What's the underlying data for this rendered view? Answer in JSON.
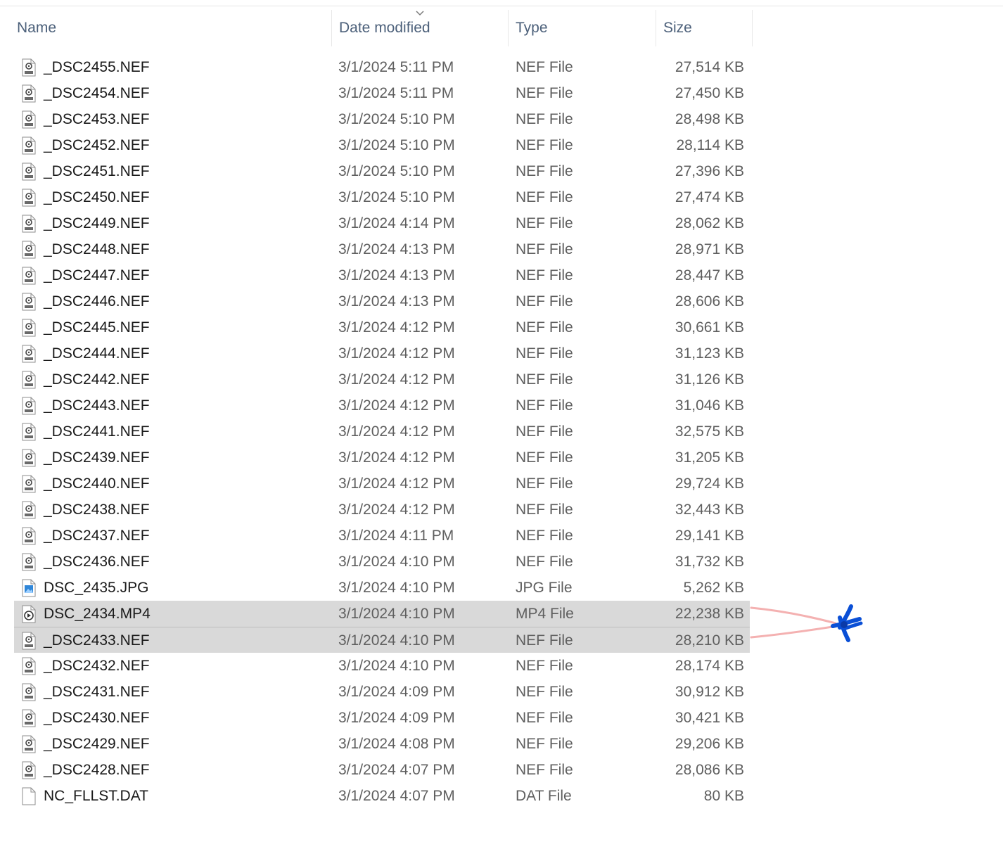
{
  "columns": {
    "name": "Name",
    "date": "Date modified",
    "type": "Type",
    "size": "Size"
  },
  "sort": {
    "column": "Date modified",
    "direction": "descending",
    "icon": "chevron-down-icon"
  },
  "files": [
    {
      "name": "_DSC2455.NEF",
      "date": "3/1/2024 5:11 PM",
      "type": "NEF File",
      "size": "27,514 KB",
      "icon": "nef-file-icon"
    },
    {
      "name": "_DSC2454.NEF",
      "date": "3/1/2024 5:11 PM",
      "type": "NEF File",
      "size": "27,450 KB",
      "icon": "nef-file-icon"
    },
    {
      "name": "_DSC2453.NEF",
      "date": "3/1/2024 5:10 PM",
      "type": "NEF File",
      "size": "28,498 KB",
      "icon": "nef-file-icon"
    },
    {
      "name": "_DSC2452.NEF",
      "date": "3/1/2024 5:10 PM",
      "type": "NEF File",
      "size": "28,114 KB",
      "icon": "nef-file-icon"
    },
    {
      "name": "_DSC2451.NEF",
      "date": "3/1/2024 5:10 PM",
      "type": "NEF File",
      "size": "27,396 KB",
      "icon": "nef-file-icon"
    },
    {
      "name": "_DSC2450.NEF",
      "date": "3/1/2024 5:10 PM",
      "type": "NEF File",
      "size": "27,474 KB",
      "icon": "nef-file-icon"
    },
    {
      "name": "_DSC2449.NEF",
      "date": "3/1/2024 4:14 PM",
      "type": "NEF File",
      "size": "28,062 KB",
      "icon": "nef-file-icon"
    },
    {
      "name": "_DSC2448.NEF",
      "date": "3/1/2024 4:13 PM",
      "type": "NEF File",
      "size": "28,971 KB",
      "icon": "nef-file-icon"
    },
    {
      "name": "_DSC2447.NEF",
      "date": "3/1/2024 4:13 PM",
      "type": "NEF File",
      "size": "28,447 KB",
      "icon": "nef-file-icon"
    },
    {
      "name": "_DSC2446.NEF",
      "date": "3/1/2024 4:13 PM",
      "type": "NEF File",
      "size": "28,606 KB",
      "icon": "nef-file-icon"
    },
    {
      "name": "_DSC2445.NEF",
      "date": "3/1/2024 4:12 PM",
      "type": "NEF File",
      "size": "30,661 KB",
      "icon": "nef-file-icon"
    },
    {
      "name": "_DSC2444.NEF",
      "date": "3/1/2024 4:12 PM",
      "type": "NEF File",
      "size": "31,123 KB",
      "icon": "nef-file-icon"
    },
    {
      "name": "_DSC2442.NEF",
      "date": "3/1/2024 4:12 PM",
      "type": "NEF File",
      "size": "31,126 KB",
      "icon": "nef-file-icon"
    },
    {
      "name": "_DSC2443.NEF",
      "date": "3/1/2024 4:12 PM",
      "type": "NEF File",
      "size": "31,046 KB",
      "icon": "nef-file-icon"
    },
    {
      "name": "_DSC2441.NEF",
      "date": "3/1/2024 4:12 PM",
      "type": "NEF File",
      "size": "32,575 KB",
      "icon": "nef-file-icon"
    },
    {
      "name": "_DSC2439.NEF",
      "date": "3/1/2024 4:12 PM",
      "type": "NEF File",
      "size": "31,205 KB",
      "icon": "nef-file-icon"
    },
    {
      "name": "_DSC2440.NEF",
      "date": "3/1/2024 4:12 PM",
      "type": "NEF File",
      "size": "29,724 KB",
      "icon": "nef-file-icon"
    },
    {
      "name": "_DSC2438.NEF",
      "date": "3/1/2024 4:12 PM",
      "type": "NEF File",
      "size": "32,443 KB",
      "icon": "nef-file-icon"
    },
    {
      "name": "_DSC2437.NEF",
      "date": "3/1/2024 4:11 PM",
      "type": "NEF File",
      "size": "29,141 KB",
      "icon": "nef-file-icon"
    },
    {
      "name": "_DSC2436.NEF",
      "date": "3/1/2024 4:10 PM",
      "type": "NEF File",
      "size": "31,732 KB",
      "icon": "nef-file-icon"
    },
    {
      "name": "DSC_2435.JPG",
      "date": "3/1/2024 4:10 PM",
      "type": "JPG File",
      "size": "5,262 KB",
      "icon": "image-file-icon"
    },
    {
      "name": "DSC_2434.MP4",
      "date": "3/1/2024 4:10 PM",
      "type": "MP4 File",
      "size": "22,238 KB",
      "icon": "video-file-icon",
      "selected": true
    },
    {
      "name": "_DSC2433.NEF",
      "date": "3/1/2024 4:10 PM",
      "type": "NEF File",
      "size": "28,210 KB",
      "icon": "nef-file-icon",
      "selected": true
    },
    {
      "name": "_DSC2432.NEF",
      "date": "3/1/2024 4:10 PM",
      "type": "NEF File",
      "size": "28,174 KB",
      "icon": "nef-file-icon"
    },
    {
      "name": "_DSC2431.NEF",
      "date": "3/1/2024 4:09 PM",
      "type": "NEF File",
      "size": "30,912 KB",
      "icon": "nef-file-icon"
    },
    {
      "name": "_DSC2430.NEF",
      "date": "3/1/2024 4:09 PM",
      "type": "NEF File",
      "size": "30,421 KB",
      "icon": "nef-file-icon"
    },
    {
      "name": "_DSC2429.NEF",
      "date": "3/1/2024 4:08 PM",
      "type": "NEF File",
      "size": "29,206 KB",
      "icon": "nef-file-icon"
    },
    {
      "name": "_DSC2428.NEF",
      "date": "3/1/2024 4:07 PM",
      "type": "NEF File",
      "size": "28,086 KB",
      "icon": "nef-file-icon"
    },
    {
      "name": "NC_FLLST.DAT",
      "date": "3/1/2024 4:07 PM",
      "type": "DAT File",
      "size": "80 KB",
      "icon": "blank-file-icon"
    }
  ],
  "colors": {
    "header_text": "#4c607a",
    "selection": "#d9d9d9",
    "annotation_lines": "#f2a3a3",
    "annotation_mark": "#0a4fd6"
  },
  "annotation": {
    "icon": "hand-drawn-pointer-icon"
  }
}
